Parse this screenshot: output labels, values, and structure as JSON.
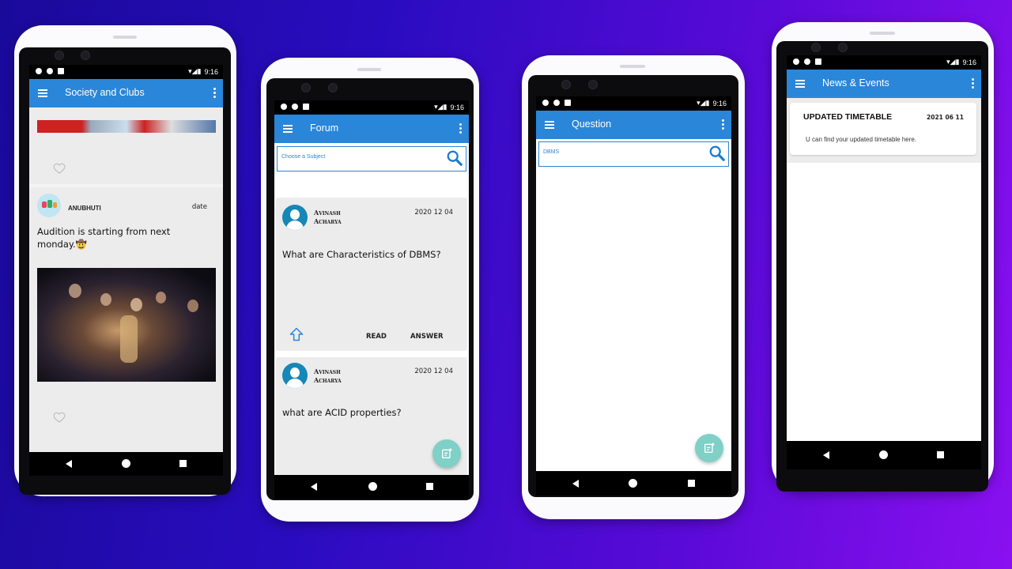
{
  "status": {
    "time": "9:16"
  },
  "phone1": {
    "title": "Society and Clubs",
    "post": {
      "author": "ANUBHUTI",
      "date": "date",
      "text": "Audition is starting from next monday.🤠"
    }
  },
  "phone2": {
    "title": "Forum",
    "search_placeholder": "Choose a Subject",
    "posts": [
      {
        "author_first": "Avinash",
        "author_last": "Acharya",
        "date": "2020 12 04",
        "question": "What are Characteristics of DBMS?",
        "read_label": "READ",
        "answer_label": "ANSWER"
      },
      {
        "author_first": "Avinash",
        "author_last": "Acharya",
        "date": "2020 12 04",
        "question": "what are ACID properties?"
      }
    ]
  },
  "phone3": {
    "title": "Question",
    "search_value": "DBMS"
  },
  "phone4": {
    "title": "News & Events",
    "news": {
      "title": "UPDATED TIMETABLE",
      "date": "2021 06 11",
      "body": "U can find your updated timetable here."
    }
  },
  "colors": {
    "appbar": "#2a86d9",
    "fab": "#7fd0c7",
    "avatar": "#1687b6"
  },
  "icons": [
    "menu-icon",
    "more-icon",
    "search-icon",
    "heart-icon",
    "upvote-icon",
    "add-note-icon",
    "back-icon",
    "home-icon",
    "recents-icon"
  ]
}
